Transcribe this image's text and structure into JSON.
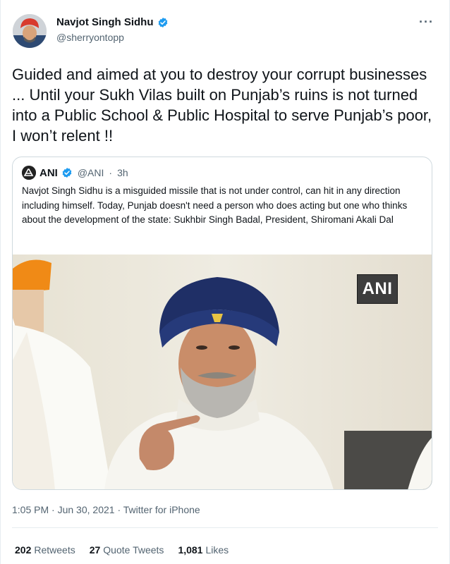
{
  "author": {
    "name": "Navjot Singh Sidhu",
    "handle": "@sherryontopp",
    "avatar_icon": "profile-photo"
  },
  "more_icon": "more-options-icon",
  "more_glyph": "···",
  "tweet": {
    "text": "Guided and aimed at you to destroy your corrupt businesses ... Until your Sukh Vilas built on Punjab’s ruins is not turned into a Public School & Public Hospital to serve Punjab’s poor, I won’t relent !!"
  },
  "quoted_tweet": {
    "name": "ANI",
    "handle": "@ANI",
    "separator": "·",
    "time": "3h",
    "text": "Navjot Singh Sidhu is a misguided missile that is not under control, can hit in any direction including himself. Today, Punjab doesn't need a person who does acting but one who thinks about the development of the state: Sukhbir Singh Badal, President, Shiromani Akali Dal",
    "image_watermark": "ANI"
  },
  "timestamp": {
    "time": "1:05 PM",
    "separator": "·",
    "date": "Jun 30, 2021",
    "source_separator": "·",
    "source": "Twitter for iPhone"
  },
  "stats": {
    "retweets_count": "202",
    "retweets_label": "Retweets",
    "quotes_count": "27",
    "quotes_label": "Quote Tweets",
    "likes_count": "1,081",
    "likes_label": "Likes"
  },
  "colors": {
    "verified": "#1d9bf0",
    "secondary_text": "#536471",
    "primary_text": "#0f1419"
  }
}
